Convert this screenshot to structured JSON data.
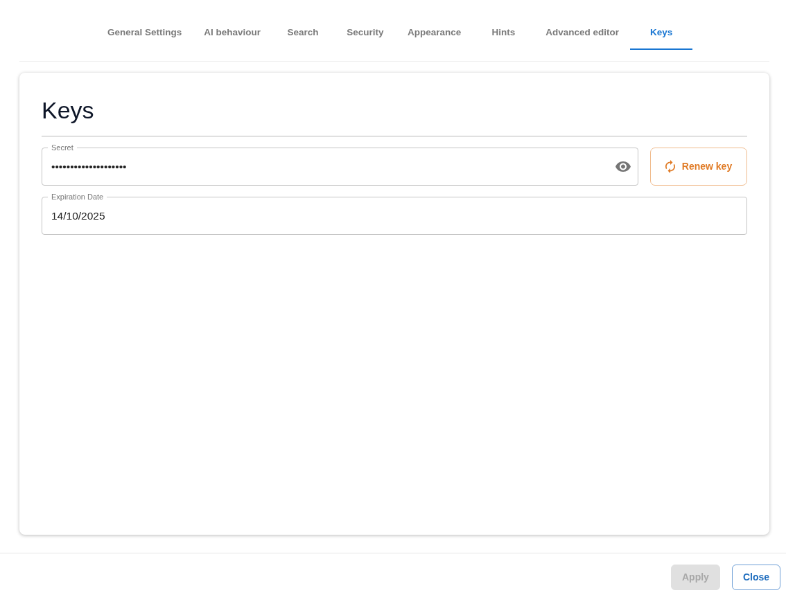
{
  "tabs": [
    {
      "label": "General Settings",
      "selected": false
    },
    {
      "label": "AI behaviour",
      "selected": false
    },
    {
      "label": "Search",
      "selected": false
    },
    {
      "label": "Security",
      "selected": false
    },
    {
      "label": "Appearance",
      "selected": false
    },
    {
      "label": "Hints",
      "selected": false
    },
    {
      "label": "Advanced editor",
      "selected": false
    },
    {
      "label": "Keys",
      "selected": true
    }
  ],
  "panel": {
    "title": "Keys",
    "fields": [
      {
        "kind": "secret",
        "label": "Secret",
        "value": "••••••••••••••••••••",
        "action": "Renew key"
      },
      {
        "kind": "date",
        "label": "Expiration Date",
        "value": "14/10/2025"
      }
    ]
  },
  "footer": {
    "buttons": [
      {
        "label": "Apply",
        "kind": "filled",
        "disabled": true
      },
      {
        "label": "Close",
        "kind": "outlined",
        "disabled": false
      }
    ]
  }
}
